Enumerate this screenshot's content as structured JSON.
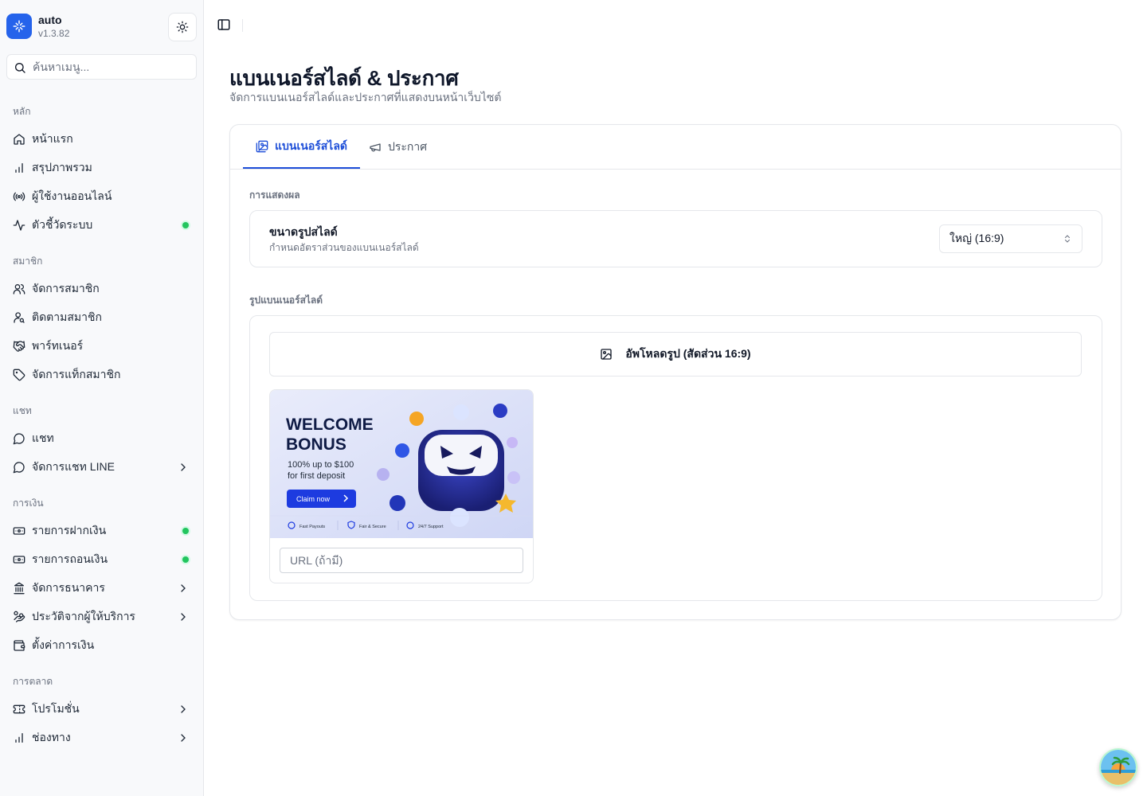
{
  "app": {
    "name": "auto",
    "version": "v1.3.82"
  },
  "search": {
    "placeholder": "ค้นหาเมนู..."
  },
  "sidebar": {
    "groups": [
      {
        "label": "หลัก",
        "items": [
          {
            "label": "หน้าแรก",
            "icon": "home-icon"
          },
          {
            "label": "สรุปภาพรวม",
            "icon": "bar-chart-icon"
          },
          {
            "label": "ผู้ใช้งานออนไลน์",
            "icon": "radio-icon"
          },
          {
            "label": "ตัวชี้วัดระบบ",
            "icon": "activity-icon",
            "status": "online"
          }
        ]
      },
      {
        "label": "สมาชิก",
        "items": [
          {
            "label": "จัดการสมาชิก",
            "icon": "users-icon"
          },
          {
            "label": "ติดตามสมาชิก",
            "icon": "user-search-icon"
          },
          {
            "label": "พาร์ทเนอร์",
            "icon": "handshake-icon"
          },
          {
            "label": "จัดการแท็กสมาชิก",
            "icon": "tag-icon"
          }
        ]
      },
      {
        "label": "แชท",
        "items": [
          {
            "label": "แชท",
            "icon": "message-circle-icon"
          },
          {
            "label": "จัดการแชท LINE",
            "icon": "message-circle-icon",
            "expandable": true
          }
        ]
      },
      {
        "label": "การเงิน",
        "items": [
          {
            "label": "รายการฝากเงิน",
            "icon": "deposit-icon",
            "status": "online"
          },
          {
            "label": "รายการถอนเงิน",
            "icon": "withdraw-icon",
            "status": "online"
          },
          {
            "label": "จัดการธนาคาร",
            "icon": "bank-icon",
            "expandable": true
          },
          {
            "label": "ประวัติจากผู้ให้บริการ",
            "icon": "hand-coins-icon",
            "expandable": true
          },
          {
            "label": "ตั้งค่าการเงิน",
            "icon": "wallet-icon"
          }
        ]
      },
      {
        "label": "การตลาด",
        "items": [
          {
            "label": "โปรโมชั่น",
            "icon": "ticket-icon",
            "expandable": true
          },
          {
            "label": "ช่องทาง",
            "icon": "bar-chart-icon",
            "expandable": true
          }
        ]
      }
    ]
  },
  "page": {
    "title": "แบนเนอร์สไลด์ & ประกาศ",
    "subtitle": "จัดการแบนเนอร์สไลด์และประกาศที่แสดงบนหน้าเว็บไซต์"
  },
  "tabs": [
    {
      "label": "แบนเนอร์สไลด์",
      "active": true
    },
    {
      "label": "ประกาศ",
      "active": false
    }
  ],
  "display": {
    "section_label": "การแสดงผล",
    "slide_size": {
      "title": "ขนาดรูปสไลด์",
      "description": "กำหนดอัตราส่วนของแบนเนอร์สไลด์",
      "value": "ใหญ่ (16:9)"
    }
  },
  "banners": {
    "section_label": "รูปแบนเนอร์สไลด์",
    "upload_label": "อัพโหลดรูป (สัดส่วน 16:9)",
    "items": [
      {
        "headline_1": "WELCOME",
        "headline_2": "BONUS",
        "offer_1": "100% up to $100",
        "offer_2": "for first deposit",
        "cta": "Claim now",
        "feature_1": "Fast Payouts",
        "feature_2": "Fair & Secure",
        "feature_3": "24/7 Support",
        "url_placeholder": "URL (ถ้ามี)"
      }
    ]
  },
  "colors": {
    "accent": "#2563eb",
    "status_online": "#22c55e"
  }
}
